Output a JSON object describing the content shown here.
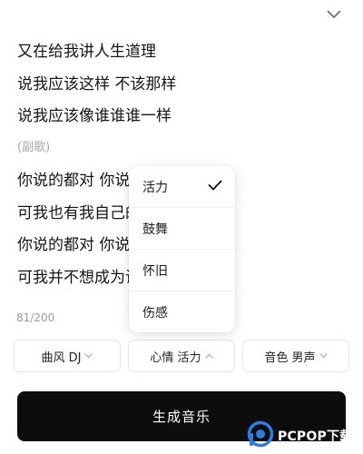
{
  "lyrics": [
    "又在给我讲人生道理",
    "说我应该这样 不该那样",
    "说我应该像谁谁谁一样",
    "(副歌)",
    "你说的都对 你说的都对",
    "可我也有我自己的梦想",
    "你说的都对 你说的都对",
    "可我并不想成为谁的模样"
  ],
  "char_counter": "81/200",
  "options": {
    "style_label": "曲风 DJ",
    "mood_label": "心情 活力",
    "voice_label": "音色 男声"
  },
  "mood_dropdown": {
    "items": [
      "活力",
      "鼓舞",
      "怀旧",
      "伤感"
    ],
    "selected": "活力"
  },
  "generate_button": "生成音乐",
  "watermark": {
    "logo_icon": "pcpop-logo-icon",
    "text": "PCPOP下载"
  },
  "colors": {
    "button_bg": "#0d0d0d",
    "button_text": "#ffffff",
    "muted_text": "#a8a8a8"
  }
}
